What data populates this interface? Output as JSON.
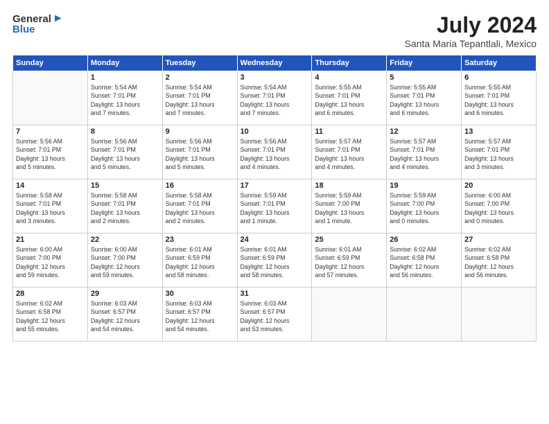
{
  "logo": {
    "general": "General",
    "blue": "Blue"
  },
  "title": {
    "month_year": "July 2024",
    "location": "Santa Maria Tepantlali, Mexico"
  },
  "weekdays": [
    "Sunday",
    "Monday",
    "Tuesday",
    "Wednesday",
    "Thursday",
    "Friday",
    "Saturday"
  ],
  "weeks": [
    [
      {
        "day": "",
        "info": ""
      },
      {
        "day": "1",
        "info": "Sunrise: 5:54 AM\nSunset: 7:01 PM\nDaylight: 13 hours\nand 7 minutes."
      },
      {
        "day": "2",
        "info": "Sunrise: 5:54 AM\nSunset: 7:01 PM\nDaylight: 13 hours\nand 7 minutes."
      },
      {
        "day": "3",
        "info": "Sunrise: 5:54 AM\nSunset: 7:01 PM\nDaylight: 13 hours\nand 7 minutes."
      },
      {
        "day": "4",
        "info": "Sunrise: 5:55 AM\nSunset: 7:01 PM\nDaylight: 13 hours\nand 6 minutes."
      },
      {
        "day": "5",
        "info": "Sunrise: 5:55 AM\nSunset: 7:01 PM\nDaylight: 13 hours\nand 6 minutes."
      },
      {
        "day": "6",
        "info": "Sunrise: 5:55 AM\nSunset: 7:01 PM\nDaylight: 13 hours\nand 6 minutes."
      }
    ],
    [
      {
        "day": "7",
        "info": "Sunrise: 5:56 AM\nSunset: 7:01 PM\nDaylight: 13 hours\nand 5 minutes."
      },
      {
        "day": "8",
        "info": "Sunrise: 5:56 AM\nSunset: 7:01 PM\nDaylight: 13 hours\nand 5 minutes."
      },
      {
        "day": "9",
        "info": "Sunrise: 5:56 AM\nSunset: 7:01 PM\nDaylight: 13 hours\nand 5 minutes."
      },
      {
        "day": "10",
        "info": "Sunrise: 5:56 AM\nSunset: 7:01 PM\nDaylight: 13 hours\nand 4 minutes."
      },
      {
        "day": "11",
        "info": "Sunrise: 5:57 AM\nSunset: 7:01 PM\nDaylight: 13 hours\nand 4 minutes."
      },
      {
        "day": "12",
        "info": "Sunrise: 5:57 AM\nSunset: 7:01 PM\nDaylight: 13 hours\nand 4 minutes."
      },
      {
        "day": "13",
        "info": "Sunrise: 5:57 AM\nSunset: 7:01 PM\nDaylight: 13 hours\nand 3 minutes."
      }
    ],
    [
      {
        "day": "14",
        "info": "Sunrise: 5:58 AM\nSunset: 7:01 PM\nDaylight: 13 hours\nand 3 minutes."
      },
      {
        "day": "15",
        "info": "Sunrise: 5:58 AM\nSunset: 7:01 PM\nDaylight: 13 hours\nand 2 minutes."
      },
      {
        "day": "16",
        "info": "Sunrise: 5:58 AM\nSunset: 7:01 PM\nDaylight: 13 hours\nand 2 minutes."
      },
      {
        "day": "17",
        "info": "Sunrise: 5:59 AM\nSunset: 7:01 PM\nDaylight: 13 hours\nand 1 minute."
      },
      {
        "day": "18",
        "info": "Sunrise: 5:59 AM\nSunset: 7:00 PM\nDaylight: 13 hours\nand 1 minute."
      },
      {
        "day": "19",
        "info": "Sunrise: 5:59 AM\nSunset: 7:00 PM\nDaylight: 13 hours\nand 0 minutes."
      },
      {
        "day": "20",
        "info": "Sunrise: 6:00 AM\nSunset: 7:00 PM\nDaylight: 13 hours\nand 0 minutes."
      }
    ],
    [
      {
        "day": "21",
        "info": "Sunrise: 6:00 AM\nSunset: 7:00 PM\nDaylight: 12 hours\nand 59 minutes."
      },
      {
        "day": "22",
        "info": "Sunrise: 6:00 AM\nSunset: 7:00 PM\nDaylight: 12 hours\nand 59 minutes."
      },
      {
        "day": "23",
        "info": "Sunrise: 6:01 AM\nSunset: 6:59 PM\nDaylight: 12 hours\nand 58 minutes."
      },
      {
        "day": "24",
        "info": "Sunrise: 6:01 AM\nSunset: 6:59 PM\nDaylight: 12 hours\nand 58 minutes."
      },
      {
        "day": "25",
        "info": "Sunrise: 6:01 AM\nSunset: 6:59 PM\nDaylight: 12 hours\nand 57 minutes."
      },
      {
        "day": "26",
        "info": "Sunrise: 6:02 AM\nSunset: 6:58 PM\nDaylight: 12 hours\nand 56 minutes."
      },
      {
        "day": "27",
        "info": "Sunrise: 6:02 AM\nSunset: 6:58 PM\nDaylight: 12 hours\nand 56 minutes."
      }
    ],
    [
      {
        "day": "28",
        "info": "Sunrise: 6:02 AM\nSunset: 6:58 PM\nDaylight: 12 hours\nand 55 minutes."
      },
      {
        "day": "29",
        "info": "Sunrise: 6:03 AM\nSunset: 6:57 PM\nDaylight: 12 hours\nand 54 minutes."
      },
      {
        "day": "30",
        "info": "Sunrise: 6:03 AM\nSunset: 6:57 PM\nDaylight: 12 hours\nand 54 minutes."
      },
      {
        "day": "31",
        "info": "Sunrise: 6:03 AM\nSunset: 6:57 PM\nDaylight: 12 hours\nand 53 minutes."
      },
      {
        "day": "",
        "info": ""
      },
      {
        "day": "",
        "info": ""
      },
      {
        "day": "",
        "info": ""
      }
    ]
  ]
}
